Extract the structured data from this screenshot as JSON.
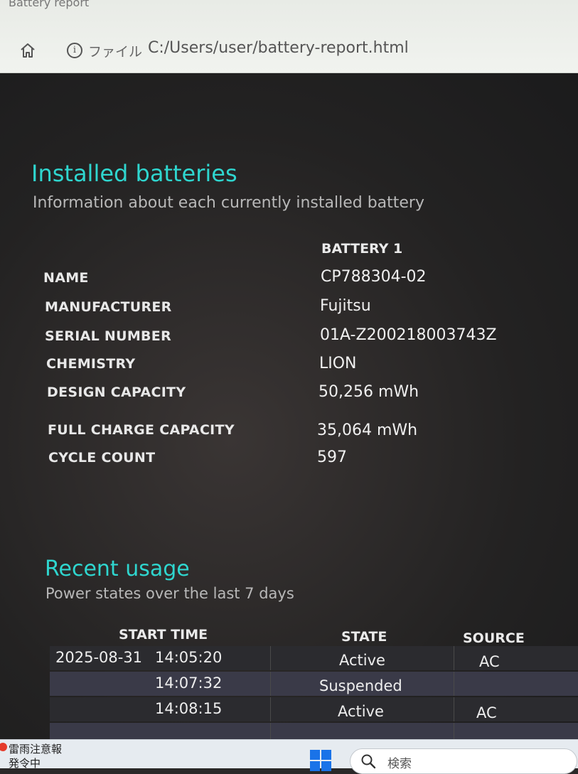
{
  "browser": {
    "tab_title": "Battery report",
    "file_label": "ファイル",
    "url": "C:/Users/user/battery-report.html"
  },
  "installed": {
    "title": "Installed batteries",
    "subtitle": "Information about each currently installed battery",
    "column_header": "BATTERY 1",
    "rows": [
      {
        "label": "NAME",
        "value": "CP788304-02"
      },
      {
        "label": "MANUFACTURER",
        "value": "Fujitsu"
      },
      {
        "label": "SERIAL NUMBER",
        "value": "01A-Z200218003743Z"
      },
      {
        "label": "CHEMISTRY",
        "value": "LION"
      },
      {
        "label": "DESIGN CAPACITY",
        "value": "50,256 mWh"
      },
      {
        "label": "FULL CHARGE CAPACITY",
        "value": "35,064 mWh"
      },
      {
        "label": "CYCLE COUNT",
        "value": "597"
      }
    ]
  },
  "usage": {
    "title": "Recent usage",
    "subtitle": "Power states over the last 7 days",
    "headers": {
      "start_time": "START TIME",
      "state": "STATE",
      "source": "SOURCE"
    },
    "rows": [
      {
        "date": "2025-08-31",
        "time": "14:05:20",
        "state": "Active",
        "source": "AC"
      },
      {
        "date": "",
        "time": "14:07:32",
        "state": "Suspended",
        "source": ""
      },
      {
        "date": "",
        "time": "14:08:15",
        "state": "Active",
        "source": "AC"
      }
    ]
  },
  "taskbar": {
    "weather_title": "雷雨注意報",
    "weather_sub": "発令中",
    "search_placeholder": "検索"
  },
  "colors": {
    "heading": "#2fd6cf",
    "page_background": "#2a2828"
  },
  "icons": [
    "home-icon",
    "info-icon",
    "windows-start-icon",
    "search-icon",
    "chevron-up-icon"
  ]
}
